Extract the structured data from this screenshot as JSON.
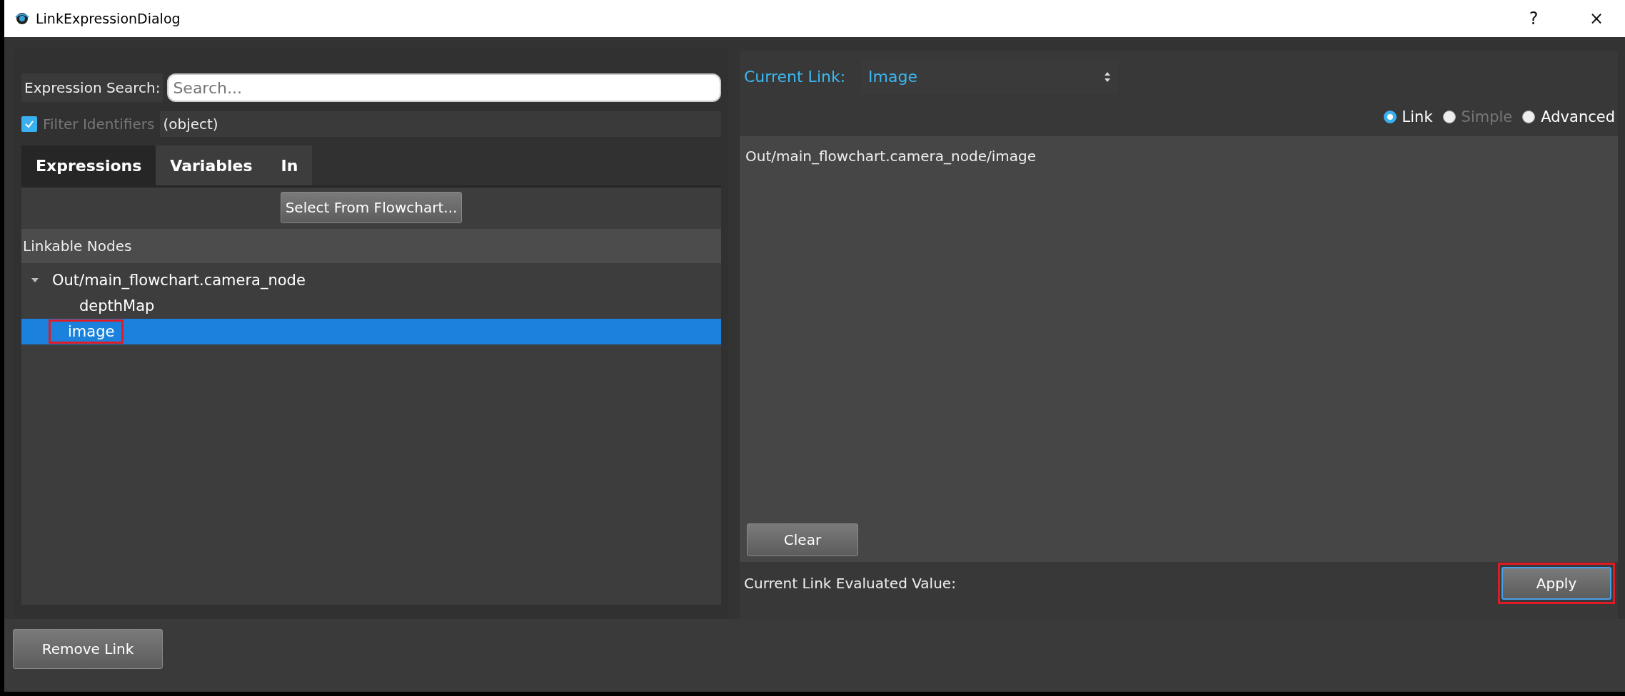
{
  "window": {
    "title": "LinkExpressionDialog",
    "buttons": [
      "?",
      "×"
    ]
  },
  "search": {
    "label": "Expression Search:",
    "placeholder": "Search..."
  },
  "filter": {
    "label": "Filter Identifiers",
    "checked": true,
    "disabled": true,
    "value": "(object)"
  },
  "tabs": [
    {
      "label": "Expressions",
      "selected": true
    },
    {
      "label": "Variables",
      "selected": false
    },
    {
      "label": "In",
      "selected": false
    }
  ],
  "select_button": "Select From Flowchart...",
  "tree": {
    "header": "Linkable Nodes",
    "items": [
      {
        "label": "Out/main_flowchart.camera_node",
        "expanded": true,
        "selected": false,
        "children": [
          {
            "label": "depthMap",
            "selected": false
          },
          {
            "label": "image",
            "selected": true,
            "highlighted": true
          }
        ]
      }
    ]
  },
  "current_link": {
    "label": "Current Link:",
    "value": "Image"
  },
  "modes": [
    {
      "label": "Link",
      "selected": true,
      "disabled": false
    },
    {
      "label": "Simple",
      "selected": false,
      "disabled": true
    },
    {
      "label": "Advanced",
      "selected": false,
      "disabled": false
    }
  ],
  "link_text": "Out/main_flowchart.camera_node/image",
  "clear_button": "Clear",
  "evaluated_label": "Current Link Evaluated Value:",
  "apply_button": {
    "label": "Apply",
    "highlighted": true
  },
  "remove_button": "Remove Link"
}
